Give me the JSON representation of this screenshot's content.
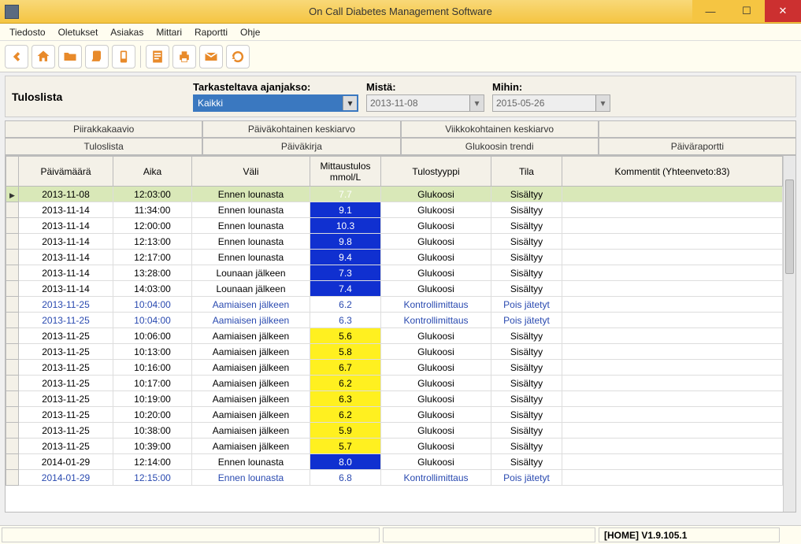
{
  "window": {
    "title": "On Call Diabetes Management Software"
  },
  "menu": {
    "items": [
      "Tiedosto",
      "Oletukset",
      "Asiakas",
      "Mittari",
      "Raportti",
      "Ohje"
    ]
  },
  "toolbar_icons": [
    "back-icon",
    "home-icon",
    "folder-icon",
    "glove-icon",
    "phone-icon",
    "doc-icon",
    "print-icon",
    "mail-icon",
    "refresh-icon"
  ],
  "panel": {
    "title": "Tuloslista",
    "period_label": "Tarkasteltava ajanjakso:",
    "period_value": "Kaikki",
    "from_label": "Mistä:",
    "from_value": "2013-11-08",
    "to_label": "Mihin:",
    "to_value": "2015-05-26"
  },
  "tabs_row1": [
    "Piirakkakaavio",
    "Päiväkohtainen keskiarvo",
    "Viikkokohtainen keskiarvo",
    ""
  ],
  "tabs_row2": [
    "Tuloslista",
    "Päiväkirja",
    "Glukoosin trendi",
    "Päiväraportti"
  ],
  "columns": {
    "date": "Päivämäärä",
    "time": "Aika",
    "interval": "Väli",
    "result": "Mittaustulos mmol/L",
    "type": "Tulostyyppi",
    "state": "Tila",
    "comment": "Kommentit (Yhteenveto:83)"
  },
  "rows": [
    {
      "date": "2013-11-08",
      "time": "12:03:00",
      "interval": "Ennen lounasta",
      "value": "7.7",
      "vclass": "val-blue",
      "type": "Glukoosi",
      "state": "Sisältyy",
      "cls": "sel"
    },
    {
      "date": "2013-11-14",
      "time": "11:34:00",
      "interval": "Ennen lounasta",
      "value": "9.1",
      "vclass": "val-blue",
      "type": "Glukoosi",
      "state": "Sisältyy",
      "cls": ""
    },
    {
      "date": "2013-11-14",
      "time": "12:00:00",
      "interval": "Ennen lounasta",
      "value": "10.3",
      "vclass": "val-blue",
      "type": "Glukoosi",
      "state": "Sisältyy",
      "cls": ""
    },
    {
      "date": "2013-11-14",
      "time": "12:13:00",
      "interval": "Ennen lounasta",
      "value": "9.8",
      "vclass": "val-blue",
      "type": "Glukoosi",
      "state": "Sisältyy",
      "cls": ""
    },
    {
      "date": "2013-11-14",
      "time": "12:17:00",
      "interval": "Ennen lounasta",
      "value": "9.4",
      "vclass": "val-blue",
      "type": "Glukoosi",
      "state": "Sisältyy",
      "cls": ""
    },
    {
      "date": "2013-11-14",
      "time": "13:28:00",
      "interval": "Lounaan jälkeen",
      "value": "7.3",
      "vclass": "val-blue",
      "type": "Glukoosi",
      "state": "Sisältyy",
      "cls": ""
    },
    {
      "date": "2013-11-14",
      "time": "14:03:00",
      "interval": "Lounaan jälkeen",
      "value": "7.4",
      "vclass": "val-blue",
      "type": "Glukoosi",
      "state": "Sisältyy",
      "cls": ""
    },
    {
      "date": "2013-11-25",
      "time": "10:04:00",
      "interval": "Aamiaisen jälkeen",
      "value": "6.2",
      "vclass": "",
      "type": "Kontrollimittaus",
      "state": "Pois jätetyt",
      "cls": "blue"
    },
    {
      "date": "2013-11-25",
      "time": "10:04:00",
      "interval": "Aamiaisen jälkeen",
      "value": "6.3",
      "vclass": "",
      "type": "Kontrollimittaus",
      "state": "Pois jätetyt",
      "cls": "blue"
    },
    {
      "date": "2013-11-25",
      "time": "10:06:00",
      "interval": "Aamiaisen jälkeen",
      "value": "5.6",
      "vclass": "val-yellow",
      "type": "Glukoosi",
      "state": "Sisältyy",
      "cls": ""
    },
    {
      "date": "2013-11-25",
      "time": "10:13:00",
      "interval": "Aamiaisen jälkeen",
      "value": "5.8",
      "vclass": "val-yellow",
      "type": "Glukoosi",
      "state": "Sisältyy",
      "cls": ""
    },
    {
      "date": "2013-11-25",
      "time": "10:16:00",
      "interval": "Aamiaisen jälkeen",
      "value": "6.7",
      "vclass": "val-yellow",
      "type": "Glukoosi",
      "state": "Sisältyy",
      "cls": ""
    },
    {
      "date": "2013-11-25",
      "time": "10:17:00",
      "interval": "Aamiaisen jälkeen",
      "value": "6.2",
      "vclass": "val-yellow",
      "type": "Glukoosi",
      "state": "Sisältyy",
      "cls": ""
    },
    {
      "date": "2013-11-25",
      "time": "10:19:00",
      "interval": "Aamiaisen jälkeen",
      "value": "6.3",
      "vclass": "val-yellow",
      "type": "Glukoosi",
      "state": "Sisältyy",
      "cls": ""
    },
    {
      "date": "2013-11-25",
      "time": "10:20:00",
      "interval": "Aamiaisen jälkeen",
      "value": "6.2",
      "vclass": "val-yellow",
      "type": "Glukoosi",
      "state": "Sisältyy",
      "cls": ""
    },
    {
      "date": "2013-11-25",
      "time": "10:38:00",
      "interval": "Aamiaisen jälkeen",
      "value": "5.9",
      "vclass": "val-yellow",
      "type": "Glukoosi",
      "state": "Sisältyy",
      "cls": ""
    },
    {
      "date": "2013-11-25",
      "time": "10:39:00",
      "interval": "Aamiaisen jälkeen",
      "value": "5.7",
      "vclass": "val-yellow",
      "type": "Glukoosi",
      "state": "Sisältyy",
      "cls": ""
    },
    {
      "date": "2014-01-29",
      "time": "12:14:00",
      "interval": "Ennen lounasta",
      "value": "8.0",
      "vclass": "val-blue",
      "type": "Glukoosi",
      "state": "Sisältyy",
      "cls": ""
    },
    {
      "date": "2014-01-29",
      "time": "12:15:00",
      "interval": "Ennen lounasta",
      "value": "6.8",
      "vclass": "",
      "type": "Kontrollimittaus",
      "state": "Pois jätetyt",
      "cls": "blue"
    }
  ],
  "status": {
    "version": "[HOME] V1.9.105.1"
  }
}
